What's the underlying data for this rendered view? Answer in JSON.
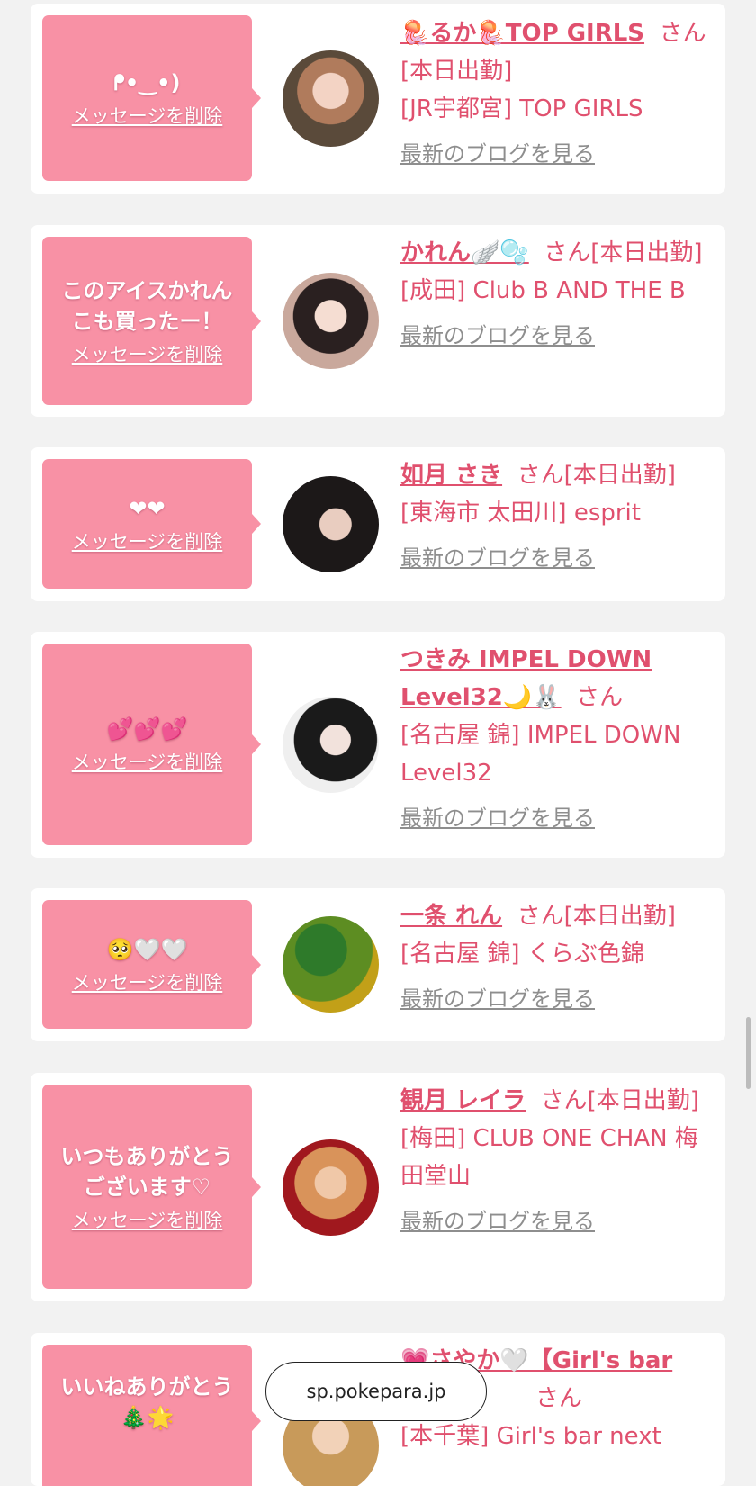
{
  "delete_label": "メッセージを削除",
  "blog_label": "最新のブログを見る",
  "cards": [
    {
      "message": "ᖰ•‿•)",
      "name": "🪼るか🪼TOP GIRLS",
      "suffix": "さん[本日出勤]",
      "shop": "[JR宇都宮] TOP GIRLS"
    },
    {
      "message": "このアイスかれん\nこも買ったー！",
      "name": "かれん🪽🫧",
      "suffix": "さん[本日出勤]",
      "shop": "[成田] Club B AND THE B"
    },
    {
      "message": "❤❤",
      "name": "如月 さき",
      "suffix": "さん[本日出勤]",
      "shop": "[東海市 太田川] esprit"
    },
    {
      "message": "💕💕💕",
      "name": "つきみ IMPEL DOWN Level32🌙🐰",
      "suffix": "さん",
      "shop": "[名古屋 錦] IMPEL DOWN Level32"
    },
    {
      "message": "🥺🤍🤍",
      "name": "一条 れん",
      "suffix": "さん[本日出勤]",
      "shop": "[名古屋 錦] くらぶ色錦"
    },
    {
      "message": "いつもありがとう\nございます♡",
      "name": "観月 レイラ",
      "suffix": "さん[本日出勤]",
      "shop": "[梅田] CLUB ONE CHAN 梅田堂山"
    },
    {
      "message": "いいねありがとう\n🎄🌟",
      "name": "💗さやか🤍【Girl's bar",
      "suffix": "さん",
      "shop": "[本千葉] Girl's bar next"
    }
  ],
  "url_label": "sp.pokepara.jp",
  "colors": {
    "bubble": "#f891a5",
    "name": "#e0506e",
    "blog": "#8e8e8e",
    "background": "#f2f2f2"
  }
}
